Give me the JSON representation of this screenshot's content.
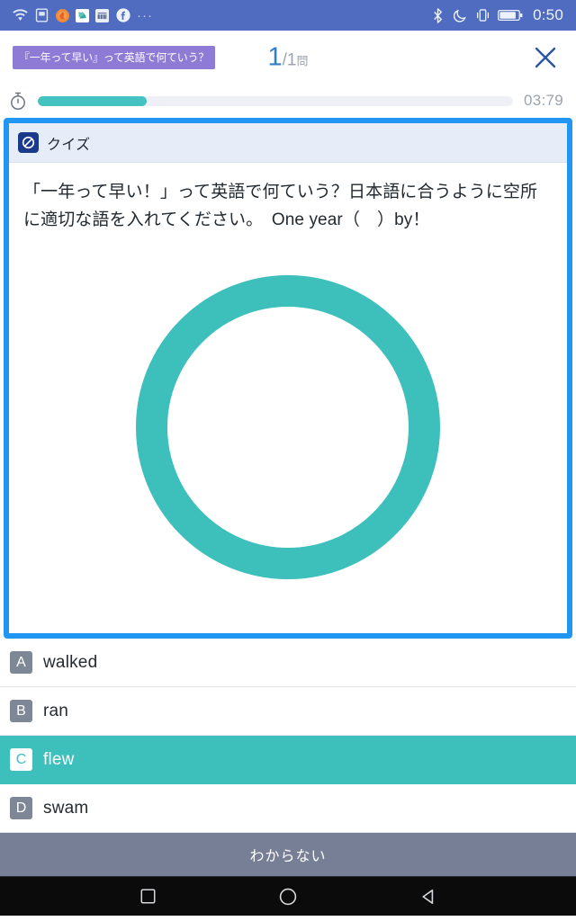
{
  "status_bar": {
    "background": "#4f6cc0",
    "left_icons": [
      {
        "name": "wifi-icon",
        "label": "wifi"
      },
      {
        "name": "sim-card-icon",
        "label": "sim"
      },
      {
        "name": "app-orange-icon",
        "label": "app"
      },
      {
        "name": "app-teal-icon",
        "label": "app"
      },
      {
        "name": "app-news-icon",
        "label": "news"
      },
      {
        "name": "facebook-icon",
        "label": "facebook"
      },
      {
        "name": "more-icons-indicator",
        "label": "···"
      }
    ],
    "right_icons": [
      {
        "name": "bluetooth-icon",
        "label": "bluetooth"
      },
      {
        "name": "do-not-disturb-moon-icon",
        "label": "do not disturb"
      },
      {
        "name": "vibrate-icon",
        "label": "vibrate"
      },
      {
        "name": "battery-icon",
        "label": "battery"
      }
    ],
    "time": "0:50"
  },
  "header": {
    "chip_label": "『一年って早い』って英語で何ていう？",
    "chip_color": "#8e7bd6",
    "current_question": "1",
    "separator": "/",
    "total_questions": "1",
    "unit": "問",
    "close_label": "×"
  },
  "timer": {
    "icon": "stopwatch-icon",
    "progress_percent": 23,
    "remaining": "03:79",
    "fill_color": "#45c3c0",
    "track_color": "#eef0f5"
  },
  "quiz_card": {
    "border_color": "#2196f3",
    "header_label": "クイズ",
    "header_icon": "quiz-badge-icon",
    "question_text": "「一年って早い！」って英語で何ていう？日本語に合うように空所に適切な語を入れてください。　One year（　）by！",
    "figure": {
      "name": "correct-circle-mark",
      "shape": "ring",
      "color": "#3dbfbc"
    }
  },
  "options": [
    {
      "letter": "A",
      "text": "walked",
      "selected": false
    },
    {
      "letter": "B",
      "text": "ran",
      "selected": false
    },
    {
      "letter": "C",
      "text": "flew",
      "selected": true
    },
    {
      "letter": "D",
      "text": "swam",
      "selected": false
    }
  ],
  "dont_know_button": {
    "label": "わからない",
    "color": "#767f95"
  },
  "nav_bar": {
    "buttons": [
      {
        "name": "recents-button",
        "shape": "square"
      },
      {
        "name": "home-button",
        "shape": "circle"
      },
      {
        "name": "back-button",
        "shape": "triangle"
      }
    ]
  }
}
